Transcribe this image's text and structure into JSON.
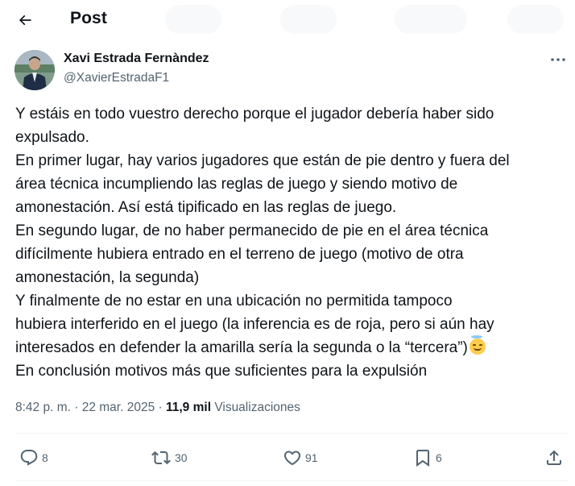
{
  "header": {
    "title": "Post",
    "back_icon": "arrow-left-icon"
  },
  "author": {
    "display_name": "Xavi Estrada Fernàndez",
    "handle": "@XavierEstradaF1",
    "avatar": "avatar-photo"
  },
  "tweet": {
    "lines": [
      "Y estáis en todo vuestro derecho porque el jugador debería haber sido",
      "expulsado.",
      "En primer lugar, hay varios jugadores que están de pie dentro y fuera del",
      "área técnica incumpliendo las reglas de juego y siendo motivo de",
      "amonestación. Así está tipificado en las reglas de juego.",
      "En segundo lugar, de no haber permanecido de pie en el área técnica",
      "difícilmente hubiera entrado en el terreno de juego (motivo de otra",
      "amonestación, la segunda)",
      "Y finalmente de no estar en una ubicación no permitida  tampoco",
      "hubiera interferido en el juego (la inferencia es de roja, pero si aún hay",
      "interesados en defender la amarilla sería la segunda o la “tercera”)",
      "En conclusión motivos más que suficientes para la expulsión"
    ],
    "emoji": "smiling-face-with-halo"
  },
  "meta": {
    "time": "8:42 p. m.",
    "sep1": " · ",
    "date": "22 mar. 2025",
    "sep2": " · ",
    "views_count": "11,9 mil",
    "views_label": "Visualizaciones"
  },
  "actions": {
    "replies": "8",
    "reposts": "30",
    "likes": "91",
    "bookmarks": "6"
  },
  "colors": {
    "text": "#0f1419",
    "secondary": "#536471",
    "divider": "#eff3f4"
  }
}
